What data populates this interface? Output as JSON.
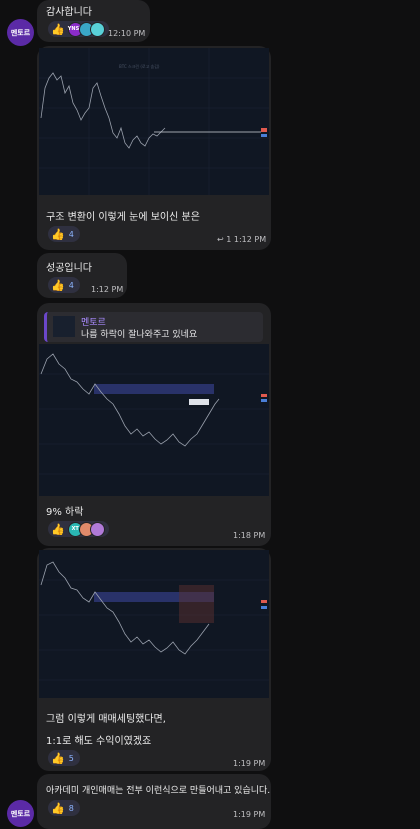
{
  "avatar_label": "멘토르",
  "messages": [
    {
      "text": "감사합니다",
      "time": "12:10 PM",
      "badge": "YNS3"
    },
    {
      "chart_watermark": "BTC 스크린 (로고 숨김)",
      "text": "구조 변환이 이렇게 눈에 보이신 분은",
      "reaction_count": "4",
      "reply_count": "1",
      "time": "1:12 PM"
    },
    {
      "text": "성공입니다",
      "reaction_count": "4",
      "time": "1:12 PM"
    },
    {
      "reply_name": "멘토르",
      "reply_text": "나름 하락이 잘나와주고 있네요",
      "text": "9% 하락",
      "badge": "XT",
      "time": "1:18 PM"
    },
    {
      "text_line1": "그럼 이렇게 매매세팅했다면,",
      "text_line2": "1:1로 해도 수익이였겠죠",
      "reaction_count": "5",
      "time": "1:19 PM"
    },
    {
      "text": "아카데미 개인매매는 전부 이런식으로 만들어내고 있습니다.",
      "reaction_count": "8",
      "time": "1:19 PM"
    }
  ],
  "colors": {
    "accent": "#6b47c9",
    "chart_bg": "#101723",
    "bubble": "#232325"
  },
  "icons": [
    "thumbs-up-icon",
    "reply-arrow-icon"
  ]
}
